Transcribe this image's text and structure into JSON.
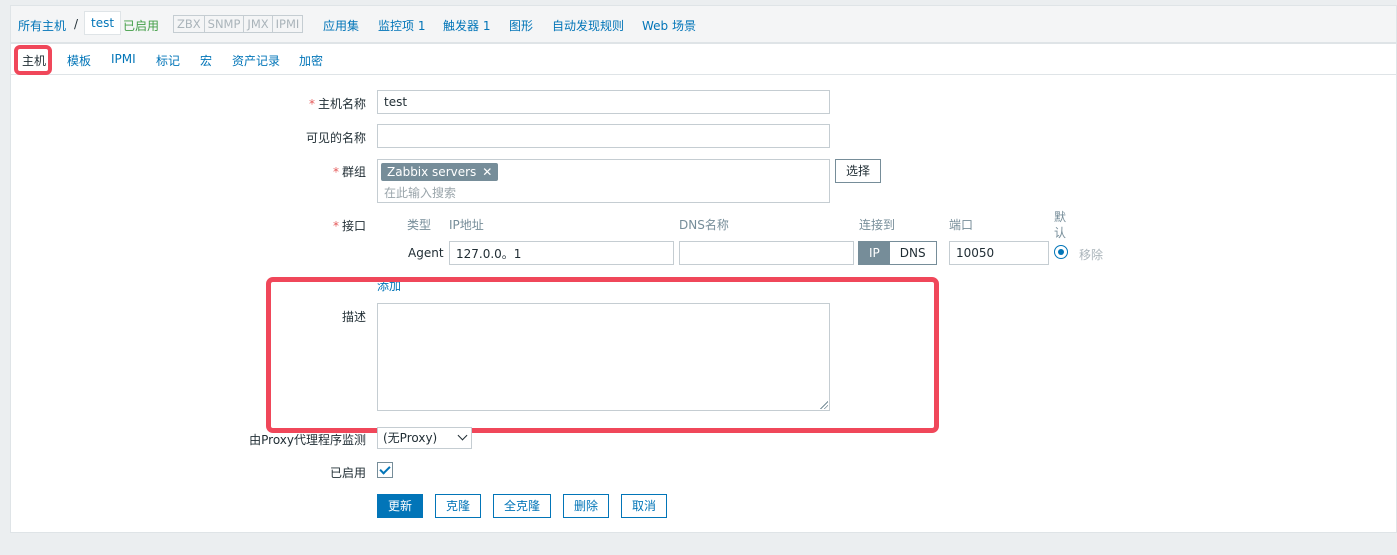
{
  "breadcrumb": {
    "all_hosts": "所有主机",
    "separator": "/",
    "current": "test"
  },
  "status": {
    "enabled": "已启用"
  },
  "availability": [
    "ZBX",
    "SNMP",
    "JMX",
    "IPMI"
  ],
  "host_nav": [
    "应用集",
    "监控项 1",
    "触发器 1",
    "图形",
    "自动发现规则",
    "Web 场景"
  ],
  "tabs": [
    "主机",
    "模板",
    "IPMI",
    "标记",
    "宏",
    "资产记录",
    "加密"
  ],
  "form": {
    "required_mark": "*",
    "host_name": {
      "label": "主机名称",
      "value": "test"
    },
    "visible_name": {
      "label": "可见的名称",
      "value": ""
    },
    "groups": {
      "label": "群组",
      "chip": "Zabbix servers",
      "chip_remove": "✕",
      "placeholder": "在此输入搜索",
      "select_button": "选择"
    },
    "interfaces": {
      "label": "接口",
      "headers": {
        "type": "类型",
        "ip": "IP地址",
        "dns": "DNS名称",
        "connect": "连接到",
        "port": "端口",
        "default_1": "默",
        "default_2": "认"
      },
      "agent": {
        "type": "Agent",
        "ip": "127.0.0。1",
        "dns": "",
        "ip_option": "IP",
        "dns_option": "DNS",
        "port": "10050",
        "remove": "移除"
      },
      "add": "添加"
    },
    "description": {
      "label": "描述",
      "value": ""
    },
    "proxy": {
      "label": "由Proxy代理程序监测",
      "value": "(无Proxy)"
    },
    "enabled": {
      "label": "已启用"
    }
  },
  "buttons": {
    "update": "更新",
    "clone": "克隆",
    "full_clone": "全克隆",
    "delete": "删除",
    "cancel": "取消"
  },
  "colors": {
    "link": "#0275b8",
    "highlight": "#f0475a",
    "enabled": "#429e47"
  }
}
